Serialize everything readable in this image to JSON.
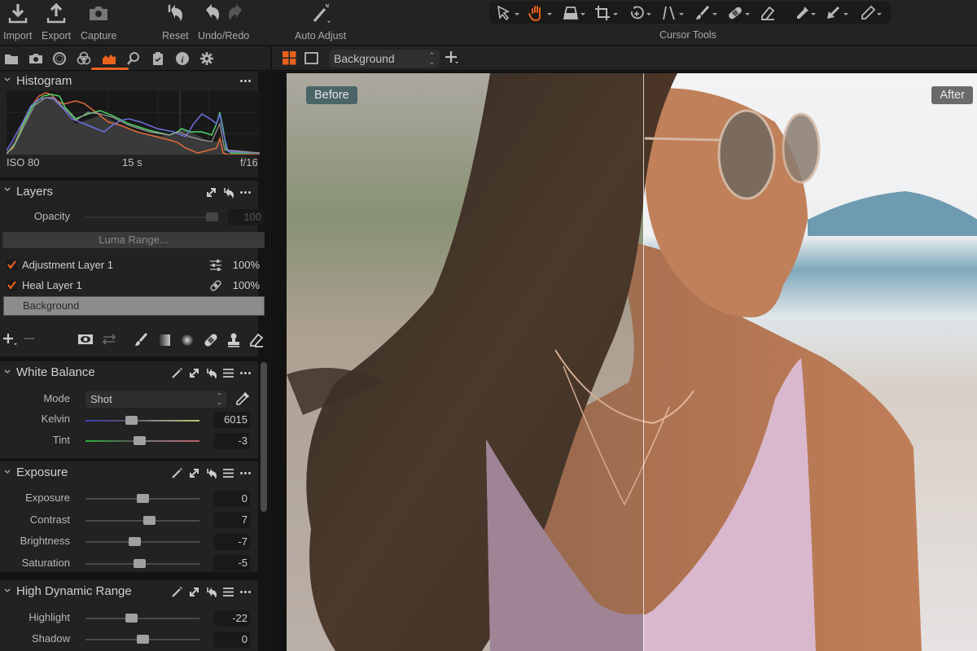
{
  "toolbar": {
    "buttons": [
      {
        "id": "import",
        "label": "Import",
        "icon": "import-icon"
      },
      {
        "id": "export",
        "label": "Export",
        "icon": "export-icon"
      },
      {
        "id": "capture",
        "label": "Capture",
        "icon": "camera-icon"
      },
      {
        "id": "reset",
        "label": "Reset",
        "icon": "reset-icon"
      },
      {
        "id": "undo_redo",
        "label": "Undo/Redo",
        "icon": "undo-redo-icon"
      },
      {
        "id": "auto_adjust",
        "label": "Auto Adjust",
        "icon": "magic-wand-icon"
      }
    ],
    "cursor_tools_label": "Cursor Tools",
    "cursor_tools": [
      "select-pointer",
      "pan-hand",
      "keystone",
      "crop",
      "rotate",
      "straighten",
      "brush",
      "heal",
      "eraser",
      "color-picker",
      "gradient-arrow",
      "annotation-pen"
    ],
    "active_cursor_tool": "pan-hand"
  },
  "tool_tabs": {
    "tabs": [
      "library",
      "capture",
      "lens",
      "color",
      "exposure",
      "details",
      "adjustments",
      "metadata",
      "settings"
    ],
    "active": "exposure"
  },
  "viewer_header": {
    "layer_selector": "Background",
    "multi_view_active": true
  },
  "histogram": {
    "title": "Histogram",
    "iso": "ISO 80",
    "shutter": "15 s",
    "aperture": "f/16"
  },
  "layers": {
    "title": "Layers",
    "opacity_label": "Opacity",
    "opacity_value": "100",
    "luma_range_label": "Luma Range...",
    "items": [
      {
        "name": "Adjustment Layer 1",
        "checked": true,
        "type_icon": "adjustment-sliders-icon",
        "opacity": "100%"
      },
      {
        "name": "Heal Layer 1",
        "checked": true,
        "type_icon": "bandage-icon",
        "opacity": "100%"
      },
      {
        "name": "Background",
        "checked": false,
        "selected": true,
        "opacity": ""
      }
    ]
  },
  "white_balance": {
    "title": "White Balance",
    "mode_label": "Mode",
    "mode_value": "Shot",
    "kelvin_label": "Kelvin",
    "kelvin_value": "6015",
    "kelvin_position": 0.4,
    "tint_label": "Tint",
    "tint_value": "-3",
    "tint_position": 0.47
  },
  "exposure": {
    "title": "Exposure",
    "rows": [
      {
        "label": "Exposure",
        "value": "0",
        "position": 0.5
      },
      {
        "label": "Contrast",
        "value": "7",
        "position": 0.56
      },
      {
        "label": "Brightness",
        "value": "-7",
        "position": 0.43
      },
      {
        "label": "Saturation",
        "value": "-5",
        "position": 0.47
      }
    ]
  },
  "hdr": {
    "title": "High Dynamic Range",
    "rows": [
      {
        "label": "Highlight",
        "value": "-22",
        "position": 0.4
      },
      {
        "label": "Shadow",
        "value": "0",
        "position": 0.5
      }
    ]
  },
  "viewer": {
    "before_label": "Before",
    "after_label": "After"
  },
  "colors": {
    "accent": "#e8621c",
    "panel_bg": "#222222",
    "before_badge": "#4b6466",
    "after_badge": "#6a6a6a"
  }
}
